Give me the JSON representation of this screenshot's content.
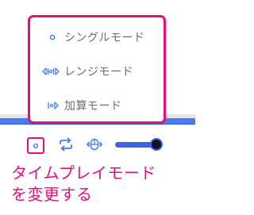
{
  "menu": {
    "items": [
      {
        "label": "シングルモード",
        "icon": "single-dot-icon"
      },
      {
        "label": "レンジモード",
        "icon": "range-icon"
      },
      {
        "label": "加算モード",
        "icon": "cumulative-icon"
      }
    ]
  },
  "toolbar": {
    "icons": [
      "single-dot-icon",
      "loop-icon",
      "gamepad-icon"
    ],
    "slider_value": 0.95
  },
  "caption": {
    "line1": "タイムプレイモード",
    "line2": "を変更する"
  },
  "colors": {
    "accent_pink": "#e2107b",
    "accent_blue": "#4a7bf6",
    "slider_blue": "#3c63e4",
    "menu_text": "#6a6d78"
  }
}
